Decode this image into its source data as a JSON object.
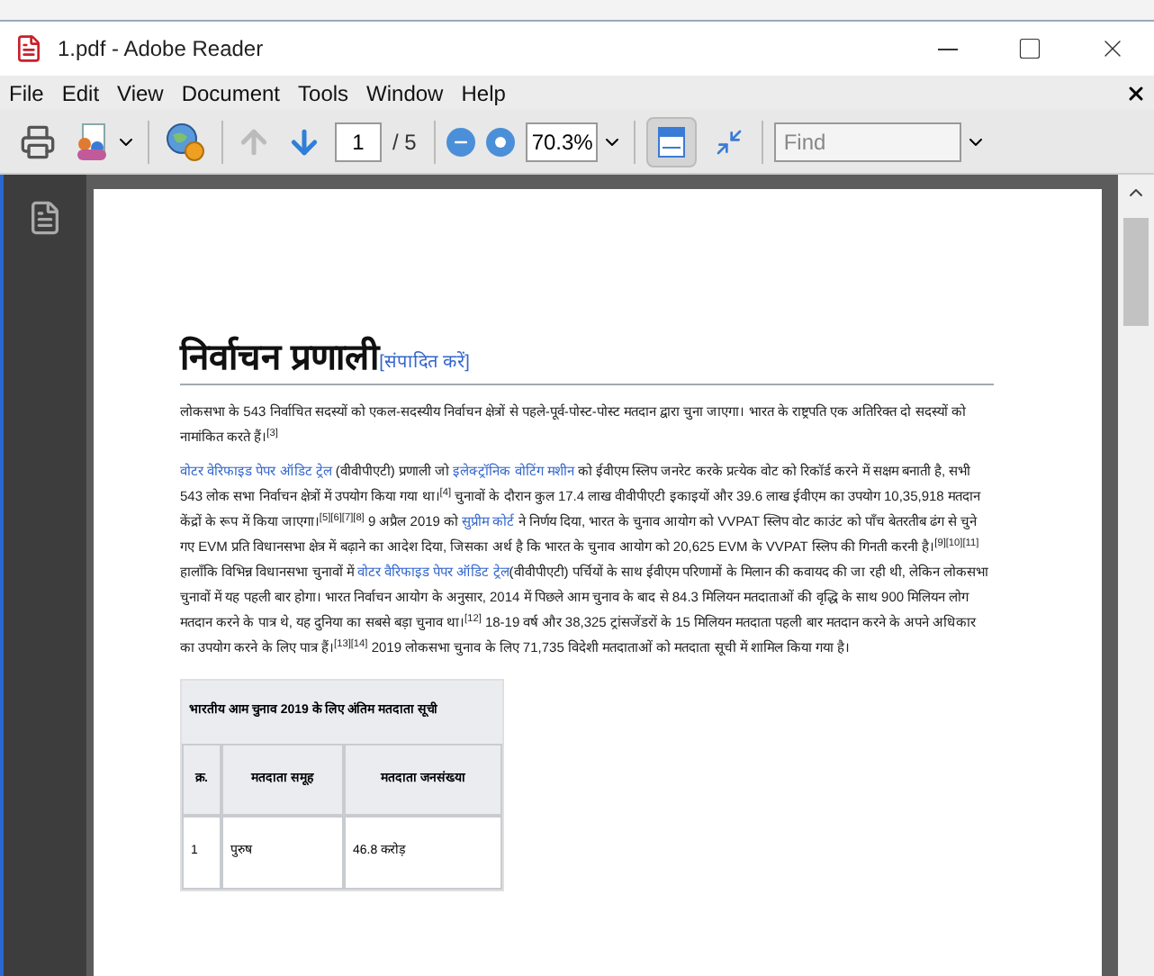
{
  "window": {
    "title": "1.pdf - Adobe Reader"
  },
  "menu": [
    "File",
    "Edit",
    "View",
    "Document",
    "Tools",
    "Window",
    "Help"
  ],
  "toolbar": {
    "page": "1",
    "page_total": "/ 5",
    "zoom": "70.3%",
    "find_placeholder": "Find"
  },
  "document": {
    "heading": "निर्वाचन प्रणाली",
    "edit_link": "[संपादित करें]",
    "paragraphs": [
      [
        {
          "text": "लोकसभा के 543 निर्वाचित सदस्यों को एकल-सदस्यीय निर्वाचन क्षेत्रों से पहले-पूर्व-पोस्ट-पोस्ट मतदान द्वारा चुना जाएगा। भारत के राष्ट्रपति एक अतिरिक्त दो सदस्यों को नामांकित करते हैं।$^{[3]}$",
          "link": false
        }
      ],
      [
        {
          "text": "वोटर वेरिफाइड पेपर ऑडिट ट्रेल",
          "link": true
        },
        {
          "text": " (वीवीपीएटी) प्रणाली जो ",
          "link": false
        },
        {
          "text": "इलेक्ट्रॉनिक वोटिंग मशीन",
          "link": true
        },
        {
          "text": " को ईवीएम स्लिप जनरेट करके प्रत्येक वोट को रिकॉर्ड करने में सक्षम बनाती है, सभी 543 लोक सभा निर्वाचन क्षेत्रों में उपयोग किया गया था।$^{[4]}$ चुनावों के दौरान कुल 17.4 लाख वीवीपीएटी इकाइयों और 39.6 लाख ईवीएम का उपयोग 10,35,918 मतदान केंद्रों के रूप में किया जाएगा।$^{[5][6][7][8]}$ 9 अप्रैल 2019 को ",
          "link": false
        },
        {
          "text": "सुप्रीम कोर्ट",
          "link": true
        },
        {
          "text": " ने निर्णय दिया, भारत के चुनाव आयोग को VVPAT स्लिप वोट काउंट को पाँच बेतरतीब ढंग से चुने गए EVM प्रति विधानसभा क्षेत्र में बढ़ाने का आदेश दिया, जिसका अर्थ है कि भारत के चुनाव आयोग को 20,625 EVM के VVPAT स्लिप की गिनती करनी है।$^{[9][10][11]}$ हालाँकि विभिन्न विधानसभा चुनावों में ",
          "link": false
        },
        {
          "text": "वोटर वैरिफाइड पेपर ऑडिट ट्रेल",
          "link": true
        },
        {
          "text": "(वीवीपीएटी) पर्चियों के साथ ईवीएम परिणामों के मिलान की कवायद की जा रही थी, लेकिन लोकसभा चुनावों में यह पहली बार होगा। भारत निर्वाचन आयोग के अनुसार, 2014 में पिछले आम चुनाव के बाद से 84.3 मिलियन मतदाताओं की वृद्धि के साथ 900 मिलियन लोग मतदान करने के पात्र थे, यह दुनिया का सबसे बड़ा चुनाव था।$^{[12]}$ 18-19 वर्ष और 38,325 ट्रांसजेंडरों के 15 मिलियन मतदाता पहली बार मतदान करने के अपने अधिकार का उपयोग करने के लिए पात्र हैं।$^{[13][14]}$ 2019 लोकसभा चुनाव के लिए 71,735 विदेशी मतदाताओं को मतदाता सूची में शामिल किया गया है।",
          "link": false
        }
      ]
    ],
    "table": {
      "caption": "भारतीय आम चुनाव 2019 के लिए अंतिम मतदाता सूची",
      "columns": [
        "क्र.",
        "मतदाता समूह",
        "मतदाता जनसंख्या"
      ],
      "rows": [
        [
          "1",
          "पुरुष",
          "46.8 करोड़"
        ]
      ]
    }
  }
}
